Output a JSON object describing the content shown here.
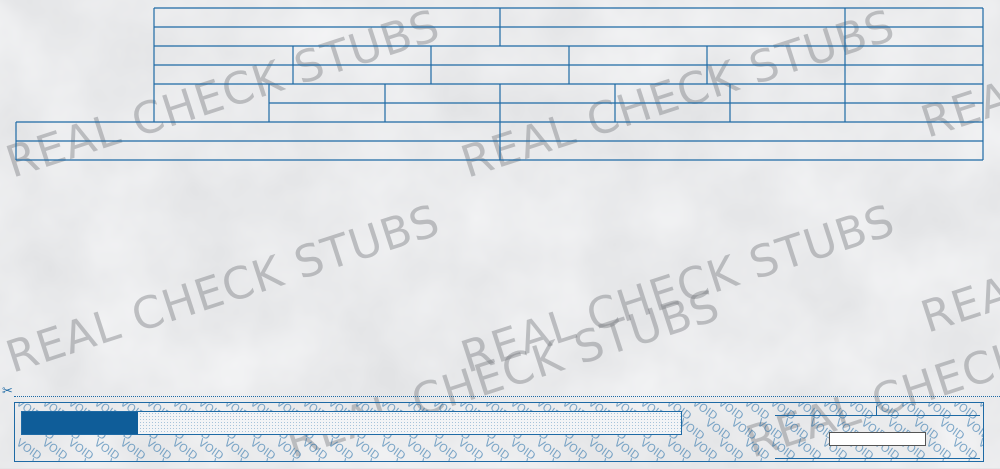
{
  "watermark": {
    "text": "REAL CHECK STUBS",
    "color": "#7a7c80"
  },
  "check": {
    "void_text": "VOID",
    "amount_progress": 0.176
  },
  "colors": {
    "line": "#1e6aa5",
    "amount_fill": "#0f5d99",
    "background": "#e4e5e7"
  },
  "icons": {
    "tear_line": "scissors-icon"
  }
}
